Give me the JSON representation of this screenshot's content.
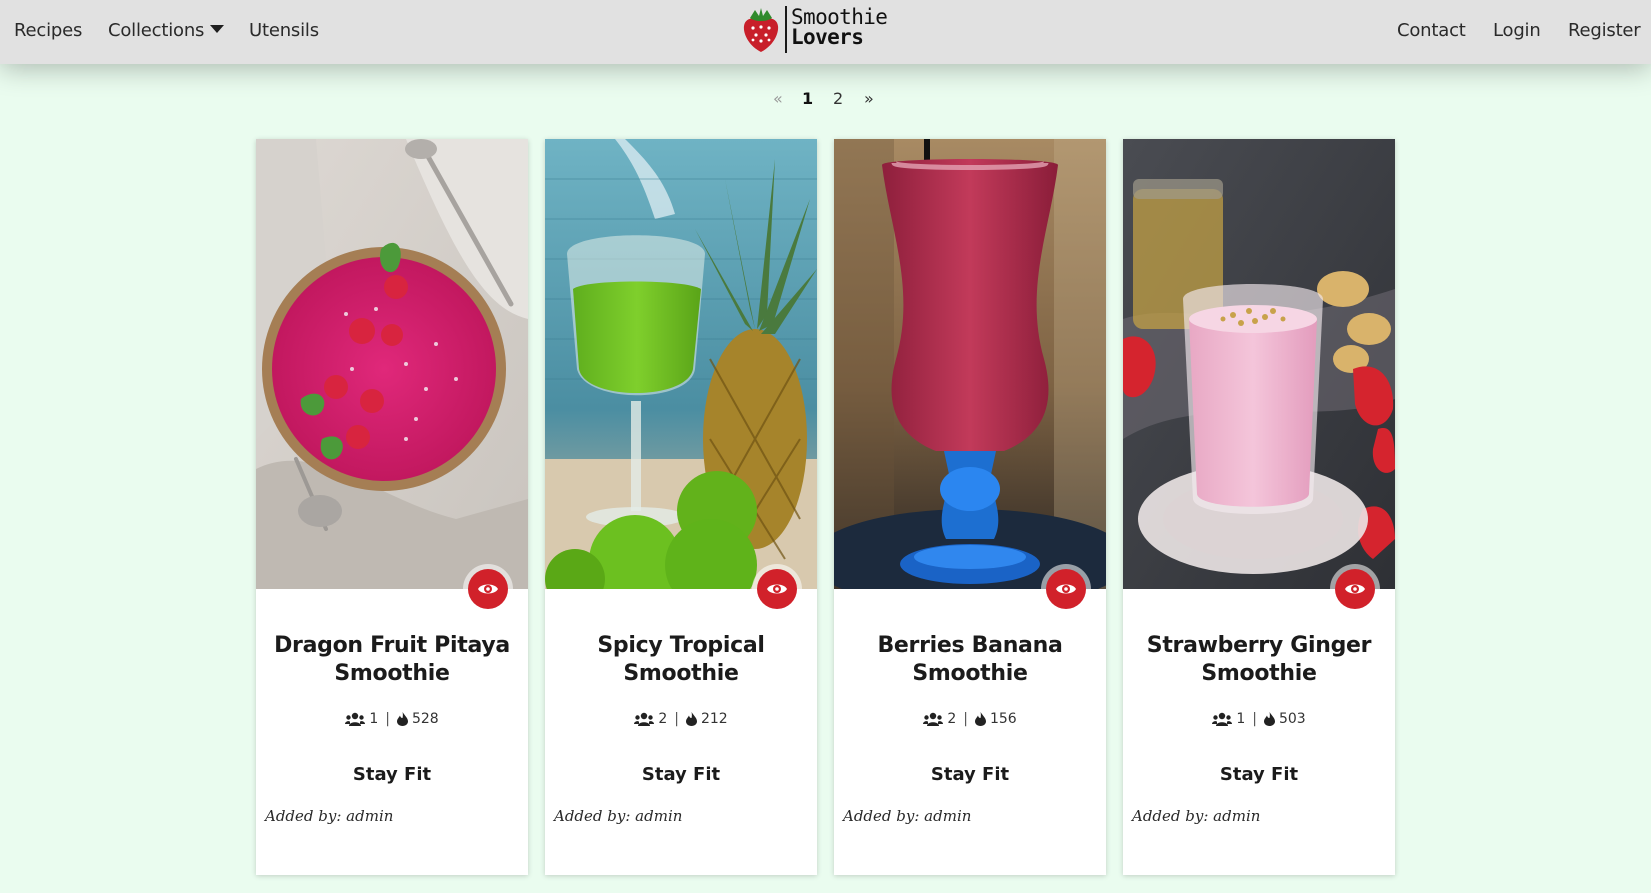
{
  "nav": {
    "left": [
      "Recipes",
      "Collections",
      "Utensils"
    ],
    "brand": {
      "line1": "Smoothie",
      "line2": "Lovers"
    },
    "right": [
      "Contact",
      "Login",
      "Register"
    ]
  },
  "pagination": {
    "prev": "«",
    "pages": [
      "1",
      "2"
    ],
    "next": "»",
    "current": "1"
  },
  "cards": [
    {
      "title": "Dragon Fruit Pitaya Smoothie",
      "servings": "1",
      "calories": "528",
      "category": "Stay Fit",
      "author": "Added by: admin"
    },
    {
      "title": "Spicy Tropical Smoothie",
      "servings": "2",
      "calories": "212",
      "category": "Stay Fit",
      "author": "Added by: admin"
    },
    {
      "title": "Berries Banana Smoothie",
      "servings": "2",
      "calories": "156",
      "category": "Stay Fit",
      "author": "Added by: admin"
    },
    {
      "title": "Strawberry Ginger Smoothie",
      "servings": "1",
      "calories": "503",
      "category": "Stay Fit",
      "author": "Added by: admin"
    }
  ],
  "icons": {
    "users": "users-icon",
    "calories": "flame-icon",
    "view": "eye-icon",
    "dropdown": "caret-down-icon",
    "logo": "strawberry-icon"
  },
  "colors": {
    "accent": "#d1212a",
    "page_background": "#eafcef",
    "navbar": "#e1e1e1"
  }
}
